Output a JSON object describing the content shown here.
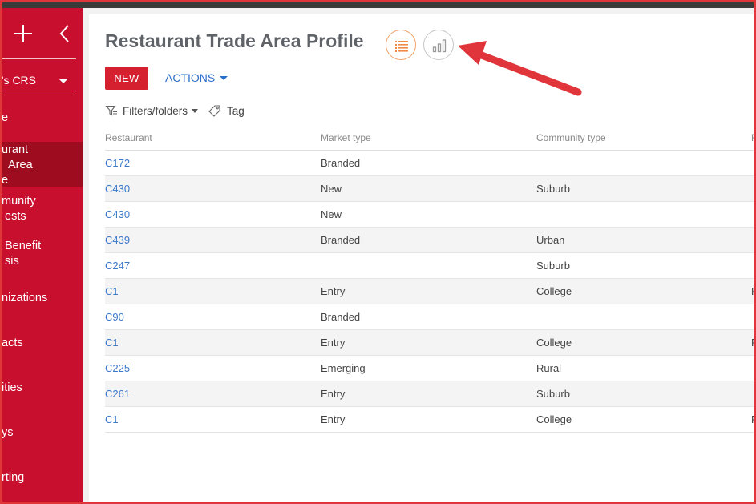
{
  "sidebar": {
    "workspace": "'s CRS",
    "items": [
      {
        "line1": "e",
        "line2": "",
        "line3": ""
      },
      {
        "line1": "urant",
        "line2": "Area",
        "line3": "e"
      },
      {
        "line1": "munity",
        "line2": "ests",
        "line3": ""
      },
      {
        "line1": "Benefit",
        "line2": "sis",
        "line3": ""
      },
      {
        "line1": "nizations",
        "line2": "",
        "line3": ""
      },
      {
        "line1": "acts",
        "line2": "",
        "line3": ""
      },
      {
        "line1": "ities",
        "line2": "",
        "line3": ""
      },
      {
        "line1": "ys",
        "line2": "",
        "line3": ""
      },
      {
        "line1": "rting",
        "line2": "",
        "line3": ""
      }
    ],
    "icons": [
      "plus-icon",
      "chevron-left-icon",
      "chevron-down-icon"
    ]
  },
  "header": {
    "title": "Restaurant Trade Area Profile",
    "views": [
      {
        "name": "list-view",
        "icon": "list-icon",
        "active": true
      },
      {
        "name": "analytics-view",
        "icon": "bar-chart-icon",
        "active": false
      }
    ]
  },
  "toolbar": {
    "new_label": "NEW",
    "actions_label": "ACTIONS",
    "filters_label": "Filters/folders",
    "tag_label": "Tag"
  },
  "grid": {
    "columns": [
      "Restaurant",
      "Market type",
      "Community type",
      "R"
    ],
    "rows": [
      [
        "C172",
        "Branded",
        "",
        ""
      ],
      [
        "C430",
        "New",
        "Suburb",
        ""
      ],
      [
        "C430",
        "New",
        "",
        ""
      ],
      [
        "C439",
        "Branded",
        "Urban",
        ""
      ],
      [
        "C247",
        "",
        "Suburb",
        ""
      ],
      [
        "C1",
        "Entry",
        "College",
        "F"
      ],
      [
        "C90",
        "Branded",
        "",
        ""
      ],
      [
        "C1",
        "Entry",
        "College",
        "F"
      ],
      [
        "C225",
        "Emerging",
        "Rural",
        ""
      ],
      [
        "C261",
        "Entry",
        "Suburb",
        ""
      ],
      [
        "C1",
        "Entry",
        "College",
        "F"
      ]
    ]
  },
  "colors": {
    "brand": "#c8102e",
    "sidebar_active": "#9e0d1f",
    "primary_button": "#d4202f",
    "link": "#3a78c9",
    "list_view_border": "#f4a26b",
    "annotation_arrow": "#e0353a"
  }
}
